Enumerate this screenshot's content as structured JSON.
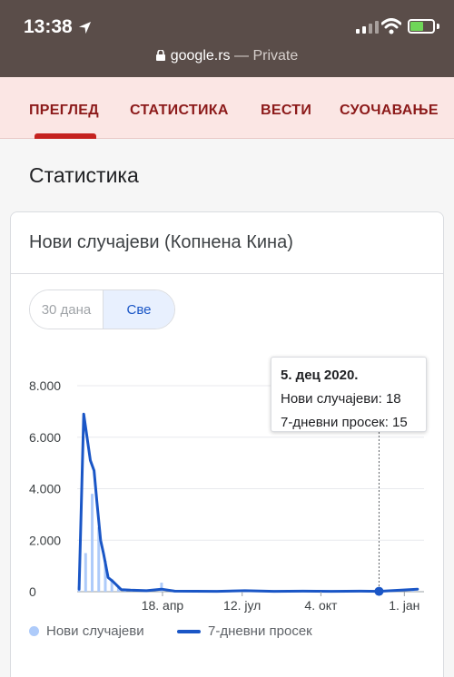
{
  "status_bar": {
    "time": "13:38",
    "url_host": "google.rs",
    "url_suffix": " — Private"
  },
  "tabs": [
    {
      "label": "ПРЕГЛЕД",
      "active": true
    },
    {
      "label": "СТАТИСТИКА",
      "active": false
    },
    {
      "label": "ВЕСТИ",
      "active": false
    },
    {
      "label": "СУОЧАВАЊЕ",
      "active": false
    }
  ],
  "page_title": "Статистика",
  "card": {
    "title": "Нови случајеви (Копнена Кина)",
    "range_toggle": {
      "option_30": "30 дана",
      "option_all": "Све",
      "selected": "Све"
    }
  },
  "tooltip": {
    "date": "5. дец 2020.",
    "new_cases": "Нови случајеви: 18",
    "avg": "7-дневни просек: 15"
  },
  "legend": {
    "bars": "Нови случајеви",
    "line": "7-дневни просек"
  },
  "colors": {
    "accent": "#c5221f",
    "line": "#1a56c6",
    "bars": "#aecbfa"
  },
  "chart_data": {
    "type": "bar",
    "title": "Нови случајеви (Копнена Кина)",
    "y_ticks": [
      "0",
      "2.000",
      "4.000",
      "6.000",
      "8.000"
    ],
    "ylim": [
      0,
      8000
    ],
    "x_ticks": [
      "18. апр",
      "12. јул",
      "4. окт",
      "1. јан"
    ],
    "series": [
      {
        "name": "Нови случајеви",
        "type": "bar",
        "x": [
          "2020-01-20",
          "2020-01-27",
          "2020-02-03",
          "2020-02-10",
          "2020-02-17",
          "2020-02-24",
          "2020-03-02",
          "2020-03-09",
          "2020-03-16",
          "2020-03-23",
          "2020-04-01",
          "2020-04-17",
          "2020-05-01",
          "2020-06-15",
          "2020-07-15",
          "2020-08-15",
          "2020-09-15",
          "2020-10-15",
          "2020-11-15",
          "2020-12-05",
          "2021-01-10"
        ],
        "values": [
          200,
          1500,
          3800,
          2500,
          1200,
          500,
          150,
          40,
          60,
          100,
          50,
          350,
          10,
          20,
          15,
          20,
          10,
          15,
          15,
          18,
          80
        ]
      },
      {
        "name": "7-дневни просек",
        "type": "line",
        "x": [
          "2020-01-20",
          "2020-01-25",
          "2020-02-01",
          "2020-02-05",
          "2020-02-08",
          "2020-02-12",
          "2020-02-15",
          "2020-02-20",
          "2020-02-25",
          "2020-03-05",
          "2020-03-15",
          "2020-04-01",
          "2020-04-17",
          "2020-05-01",
          "2020-06-15",
          "2020-07-15",
          "2020-08-15",
          "2020-09-15",
          "2020-10-15",
          "2020-11-15",
          "2020-12-05",
          "2021-01-15"
        ],
        "values": [
          100,
          6900,
          5100,
          4700,
          3500,
          2000,
          1500,
          550,
          400,
          80,
          60,
          40,
          100,
          20,
          15,
          40,
          15,
          20,
          15,
          20,
          15,
          100
        ]
      }
    ],
    "highlight": {
      "x": "2020-12-05",
      "value": 15
    }
  }
}
